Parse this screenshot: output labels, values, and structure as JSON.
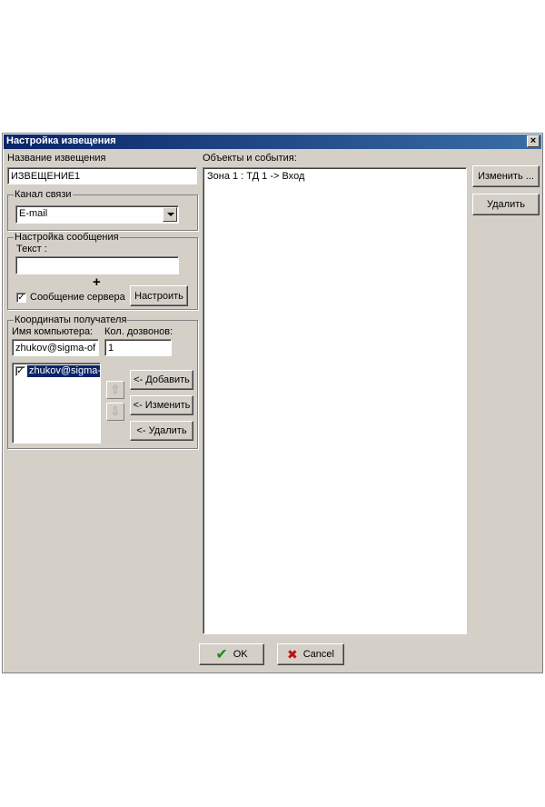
{
  "window": {
    "title": "Настройка извещения"
  },
  "name_section": {
    "label": "Название извещения",
    "value": "ИЗВЕЩЕНИЕ1"
  },
  "channel": {
    "title": "Канал связи",
    "selected": "E-mail"
  },
  "message": {
    "title": "Настройка сообщения",
    "text_label": "Текст :",
    "text_value": "",
    "plus": "+",
    "server_checkbox": {
      "checked": true,
      "mark": "✓",
      "label": "Сообщение сервера"
    },
    "setup_button": "Настроить"
  },
  "recipient": {
    "title": "Координаты получателя",
    "computer_label": "Имя компьютера:",
    "computer_value": "zhukov@sigma-offi",
    "dials_label": "Кол. дозвонов:",
    "dials_value": "1",
    "list_items": [
      {
        "label": "zhukov@sigma-o",
        "checked": true,
        "mark": "✓"
      }
    ],
    "up_arrow": "⇧",
    "down_arrow": "⇩",
    "add_button": "<- Добавить",
    "edit_button": "<- Изменить",
    "delete_button": "<- Удалить"
  },
  "objects": {
    "label": "Объекты и события:",
    "items": [
      "Зона 1 : ТД 1 -> Вход"
    ],
    "edit_button": "Изменить ...",
    "delete_button": "Удалить"
  },
  "footer": {
    "ok_label": "OK",
    "ok_icon": "✔",
    "cancel_label": "Cancel",
    "cancel_icon": "✖"
  },
  "colors": {
    "titlebar": "#0a246a",
    "selection": "#0a246a",
    "ok_icon": "#1a8a1a",
    "cancel_icon": "#c01010"
  }
}
